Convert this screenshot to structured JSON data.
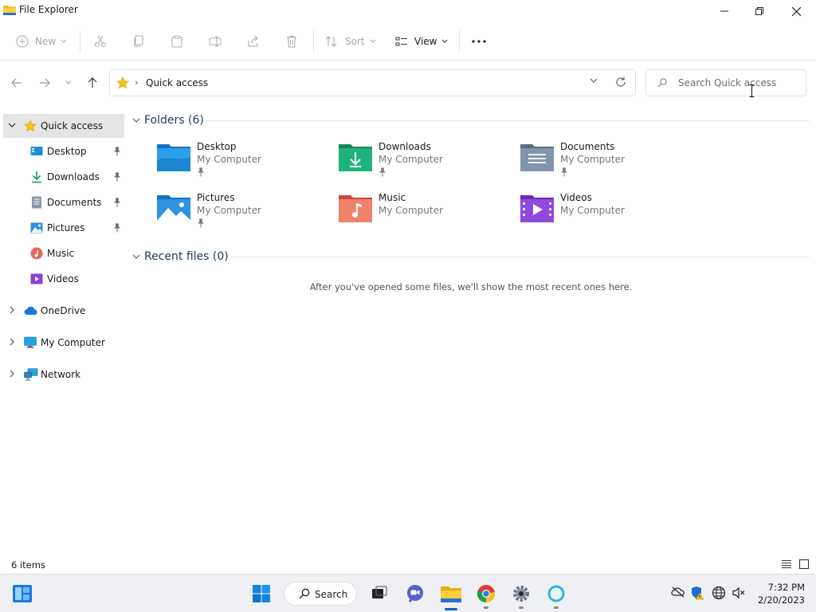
{
  "window": {
    "title": "File Explorer"
  },
  "commandbar": {
    "new_label": "New",
    "sort_label": "Sort",
    "view_label": "View"
  },
  "address": {
    "crumb": "Quick access",
    "search_placeholder": "Search Quick access"
  },
  "sidebar": {
    "items": [
      {
        "label": "Quick access",
        "icon": "star-icon"
      },
      {
        "label": "Desktop",
        "icon": "desktop-icon"
      },
      {
        "label": "Downloads",
        "icon": "download-icon"
      },
      {
        "label": "Documents",
        "icon": "document-icon"
      },
      {
        "label": "Pictures",
        "icon": "pictures-icon"
      },
      {
        "label": "Music",
        "icon": "music-icon"
      },
      {
        "label": "Videos",
        "icon": "videos-icon"
      },
      {
        "label": "OneDrive",
        "icon": "cloud-icon"
      },
      {
        "label": "My Computer",
        "icon": "computer-icon"
      },
      {
        "label": "Network",
        "icon": "network-icon"
      }
    ]
  },
  "main": {
    "folders_heading": "Folders (6)",
    "recent_heading": "Recent files (0)",
    "recent_empty": "After you've opened some files, we'll show the most recent ones here.",
    "folders": [
      {
        "name": "Desktop",
        "location": "My Computer"
      },
      {
        "name": "Downloads",
        "location": "My Computer"
      },
      {
        "name": "Documents",
        "location": "My Computer"
      },
      {
        "name": "Pictures",
        "location": "My Computer"
      },
      {
        "name": "Music",
        "location": "My Computer"
      },
      {
        "name": "Videos",
        "location": "My Computer"
      }
    ]
  },
  "status": {
    "items": "6 items"
  },
  "taskbar": {
    "search_label": "Search",
    "time": "7:32 PM",
    "date": "2/20/2023"
  },
  "colors": {
    "accent": "#0a63c9",
    "selected_bg": "#e5e5e5",
    "heading": "#1f3a5f"
  }
}
